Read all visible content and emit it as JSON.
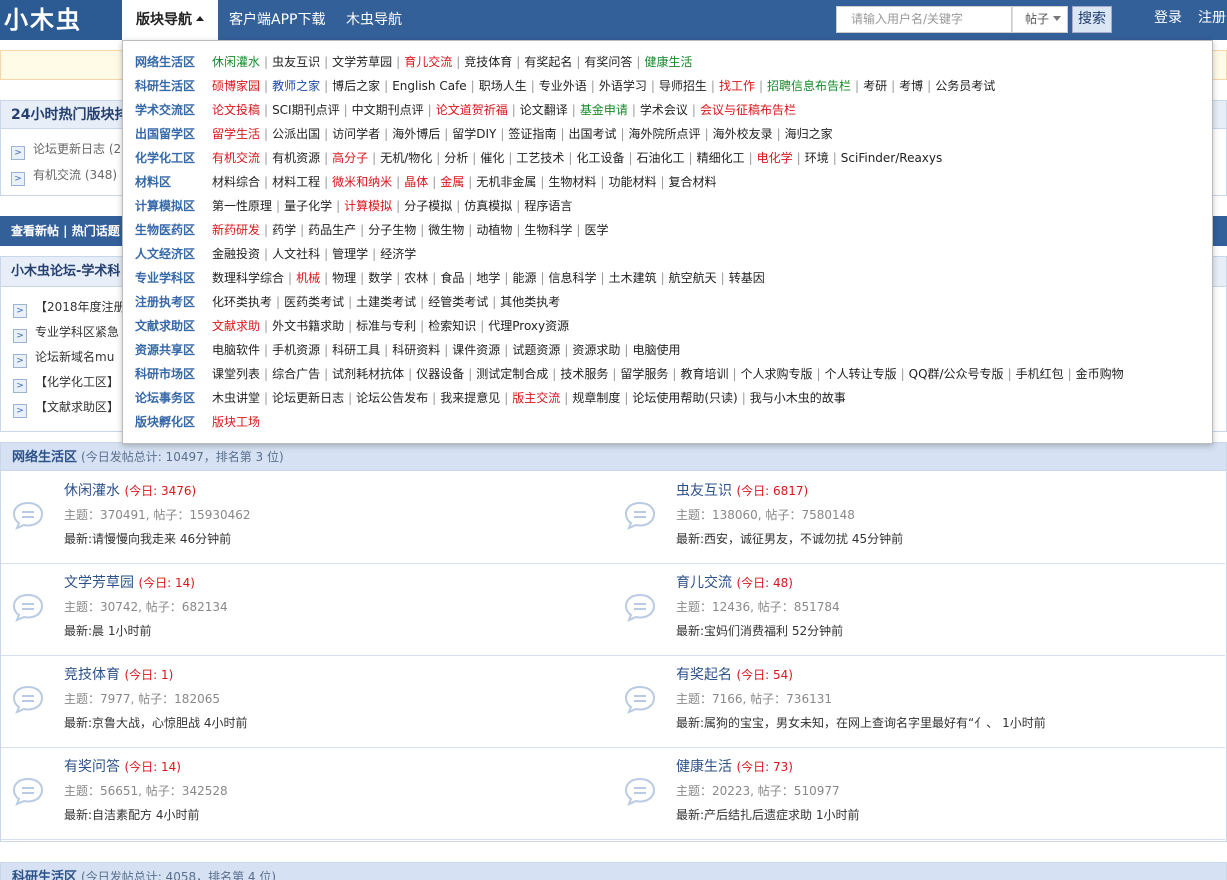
{
  "header": {
    "logo": "小木虫",
    "nav_board": "版块导航",
    "nav_app": "客户端APP下载",
    "nav_guide": "木虫导航",
    "search_placeholder": "请输入用户名/关键字",
    "search_type": "帖子",
    "search_button": "搜索",
    "login": "登录",
    "register": "注册"
  },
  "background": {
    "hot_title": "24小时热门版块排",
    "hot_rows": [
      "论坛更新日志 (2",
      "有机交流 (348)"
    ],
    "strip": "查看新帖  |  热门话题",
    "forum_title": "小木虫论坛-学术科",
    "forum_rows": [
      "【2018年度注册",
      "专业学科区紧急",
      "论坛新域名mu",
      "【化学化工区】",
      "【文献求助区】"
    ]
  },
  "dropdown": [
    {
      "name": "网络生活区",
      "links": [
        {
          "t": "休闲灌水",
          "c": "green"
        },
        {
          "t": "虫友互识"
        },
        {
          "t": "文学芳草园"
        },
        {
          "t": "育儿交流",
          "c": "red"
        },
        {
          "t": "竞技体育"
        },
        {
          "t": "有奖起名"
        },
        {
          "t": "有奖问答"
        },
        {
          "t": "健康生活",
          "c": "green"
        }
      ]
    },
    {
      "name": "科研生活区",
      "links": [
        {
          "t": "硕博家园",
          "c": "red"
        },
        {
          "t": "教师之家",
          "c": "blue"
        },
        {
          "t": "博后之家"
        },
        {
          "t": "English Cafe"
        },
        {
          "t": "职场人生"
        },
        {
          "t": "专业外语"
        },
        {
          "t": "外语学习"
        },
        {
          "t": "导师招生"
        },
        {
          "t": "找工作",
          "c": "red"
        },
        {
          "t": "招聘信息布告栏",
          "c": "green"
        },
        {
          "t": "考研"
        },
        {
          "t": "考博"
        },
        {
          "t": "公务员考试"
        }
      ]
    },
    {
      "name": "学术交流区",
      "links": [
        {
          "t": "论文投稿",
          "c": "red"
        },
        {
          "t": "SCI期刊点评"
        },
        {
          "t": "中文期刊点评"
        },
        {
          "t": "论文道贺祈福",
          "c": "red"
        },
        {
          "t": "论文翻译"
        },
        {
          "t": "基金申请",
          "c": "green"
        },
        {
          "t": "学术会议"
        },
        {
          "t": "会议与征稿布告栏",
          "c": "red"
        }
      ]
    },
    {
      "name": "出国留学区",
      "links": [
        {
          "t": "留学生活",
          "c": "red"
        },
        {
          "t": "公派出国"
        },
        {
          "t": "访问学者"
        },
        {
          "t": "海外博后"
        },
        {
          "t": "留学DIY"
        },
        {
          "t": "签证指南"
        },
        {
          "t": "出国考试"
        },
        {
          "t": "海外院所点评"
        },
        {
          "t": "海外校友录"
        },
        {
          "t": "海归之家"
        }
      ]
    },
    {
      "name": "化学化工区",
      "links": [
        {
          "t": "有机交流",
          "c": "red"
        },
        {
          "t": "有机资源"
        },
        {
          "t": "高分子",
          "c": "red"
        },
        {
          "t": "无机/物化"
        },
        {
          "t": "分析"
        },
        {
          "t": "催化"
        },
        {
          "t": "工艺技术"
        },
        {
          "t": "化工设备"
        },
        {
          "t": "石油化工"
        },
        {
          "t": "精细化工"
        },
        {
          "t": "电化学",
          "c": "red"
        },
        {
          "t": "环境"
        },
        {
          "t": "SciFinder/Reaxys"
        }
      ]
    },
    {
      "name": "材料区",
      "links": [
        {
          "t": "材料综合"
        },
        {
          "t": "材料工程"
        },
        {
          "t": "微米和纳米",
          "c": "red"
        },
        {
          "t": "晶体",
          "c": "red"
        },
        {
          "t": "金属",
          "c": "red"
        },
        {
          "t": "无机非金属"
        },
        {
          "t": "生物材料"
        },
        {
          "t": "功能材料"
        },
        {
          "t": "复合材料"
        }
      ]
    },
    {
      "name": "计算模拟区",
      "links": [
        {
          "t": "第一性原理"
        },
        {
          "t": "量子化学"
        },
        {
          "t": "计算模拟",
          "c": "red"
        },
        {
          "t": "分子模拟"
        },
        {
          "t": "仿真模拟"
        },
        {
          "t": "程序语言"
        }
      ]
    },
    {
      "name": "生物医药区",
      "links": [
        {
          "t": "新药研发",
          "c": "red"
        },
        {
          "t": "药学"
        },
        {
          "t": "药品生产"
        },
        {
          "t": "分子生物"
        },
        {
          "t": "微生物"
        },
        {
          "t": "动植物"
        },
        {
          "t": "生物科学"
        },
        {
          "t": "医学"
        }
      ]
    },
    {
      "name": "人文经济区",
      "links": [
        {
          "t": "金融投资"
        },
        {
          "t": "人文社科"
        },
        {
          "t": "管理学"
        },
        {
          "t": "经济学"
        }
      ]
    },
    {
      "name": "专业学科区",
      "links": [
        {
          "t": "数理科学综合"
        },
        {
          "t": "机械",
          "c": "red"
        },
        {
          "t": "物理"
        },
        {
          "t": "数学"
        },
        {
          "t": "农林"
        },
        {
          "t": "食品"
        },
        {
          "t": "地学"
        },
        {
          "t": "能源"
        },
        {
          "t": "信息科学"
        },
        {
          "t": "土木建筑"
        },
        {
          "t": "航空航天"
        },
        {
          "t": "转基因"
        }
      ]
    },
    {
      "name": "注册执考区",
      "links": [
        {
          "t": "化环类执考"
        },
        {
          "t": "医药类考试"
        },
        {
          "t": "土建类考试"
        },
        {
          "t": "经管类考试"
        },
        {
          "t": "其他类执考"
        }
      ]
    },
    {
      "name": "文献求助区",
      "links": [
        {
          "t": "文献求助",
          "c": "red"
        },
        {
          "t": "外文书籍求助"
        },
        {
          "t": "标准与专利"
        },
        {
          "t": "检索知识"
        },
        {
          "t": "代理Proxy资源"
        }
      ]
    },
    {
      "name": "资源共享区",
      "links": [
        {
          "t": "电脑软件"
        },
        {
          "t": "手机资源"
        },
        {
          "t": "科研工具"
        },
        {
          "t": "科研资料"
        },
        {
          "t": "课件资源"
        },
        {
          "t": "试题资源"
        },
        {
          "t": "资源求助"
        },
        {
          "t": "电脑使用"
        }
      ]
    },
    {
      "name": "科研市场区",
      "links": [
        {
          "t": "课堂列表"
        },
        {
          "t": "综合广告"
        },
        {
          "t": "试剂耗材抗体"
        },
        {
          "t": "仪器设备"
        },
        {
          "t": "测试定制合成"
        },
        {
          "t": "技术服务"
        },
        {
          "t": "留学服务"
        },
        {
          "t": "教育培训"
        },
        {
          "t": "个人求购专版"
        },
        {
          "t": "个人转让专版"
        },
        {
          "t": "QQ群/公众号专版"
        },
        {
          "t": "手机红包"
        },
        {
          "t": "金币购物"
        }
      ]
    },
    {
      "name": "论坛事务区",
      "links": [
        {
          "t": "木虫讲堂"
        },
        {
          "t": "论坛更新日志"
        },
        {
          "t": "论坛公告发布"
        },
        {
          "t": "我来提意见"
        },
        {
          "t": "版主交流",
          "c": "red"
        },
        {
          "t": "规章制度"
        },
        {
          "t": "论坛使用帮助(只读)"
        },
        {
          "t": "我与小木虫的故事"
        }
      ]
    },
    {
      "name": "版块孵化区",
      "links": [
        {
          "t": "版块工场",
          "c": "red"
        }
      ]
    }
  ],
  "section1": {
    "name": "网络生活区",
    "stat": "(今日发帖总计: 10497，排名第 3 位)",
    "boards": [
      {
        "name": "休闲灌水",
        "today": "(今日: 3476)",
        "meta": "主题：370491, 帖子：15930462",
        "latest": "最新:请慢慢向我走来  46分钟前"
      },
      {
        "name": "虫友互识",
        "today": "(今日: 6817)",
        "meta": "主题：138060, 帖子：7580148",
        "latest": "最新:西安，诚征男友，不诚勿扰  45分钟前"
      },
      {
        "name": "文学芳草园",
        "today": "(今日: 14)",
        "meta": "主题：30742, 帖子：682134",
        "latest": "最新:晨  1小时前"
      },
      {
        "name": "育儿交流",
        "today": "(今日: 48)",
        "meta": "主题：12436, 帖子：851784",
        "latest": "最新:宝妈们消费福利  52分钟前"
      },
      {
        "name": "竞技体育",
        "today": "(今日: 1)",
        "meta": "主题：7977, 帖子：182065",
        "latest": "最新:京鲁大战，心惊胆战  4小时前"
      },
      {
        "name": "有奖起名",
        "today": "(今日: 54)",
        "meta": "主题：7166, 帖子：736131",
        "latest": "最新:属狗的宝宝，男女未知，在网上查询名字里最好有“亻、  1小时前"
      },
      {
        "name": "有奖问答",
        "today": "(今日: 14)",
        "meta": "主题：56651, 帖子：342528",
        "latest": "最新:自洁素配方  4小时前"
      },
      {
        "name": "健康生活",
        "today": "(今日: 73)",
        "meta": "主题：20223, 帖子：510977",
        "latest": "最新:产后结扎后遗症求助  1小时前"
      }
    ]
  },
  "section2": {
    "name": "科研生活区",
    "stat": "(今日发帖总计: 4058，排名第 4 位)"
  }
}
